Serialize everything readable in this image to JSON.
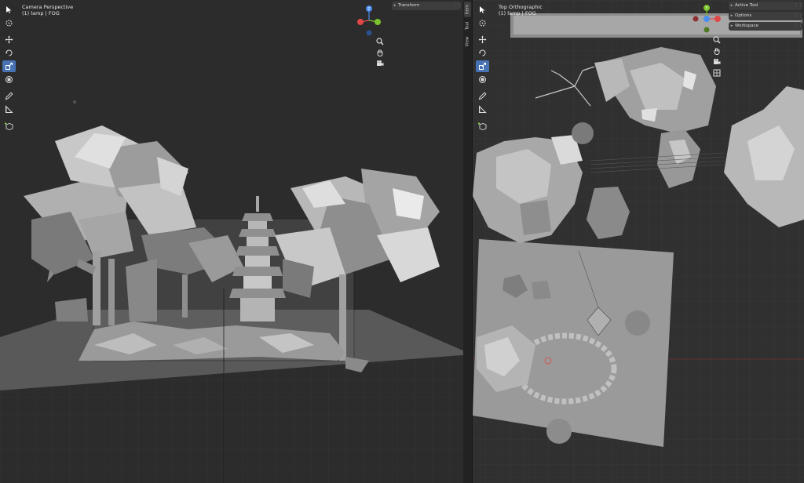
{
  "left_viewport": {
    "view_name": "Camera Perspective",
    "collection_info": "(1) lamp | FOG",
    "sidebar_panel": "Transform",
    "sidebar_tabs": [
      "Item",
      "Tool",
      "View"
    ]
  },
  "right_viewport": {
    "view_name": "Top Orthographic",
    "collection_info": "(1) lamp | FOG",
    "sidebar_panels": [
      "Active Tool",
      "Options",
      "Workspace"
    ]
  },
  "tools": [
    "select-box",
    "cursor",
    "move",
    "rotate",
    "scale",
    "transform",
    "annotate",
    "measure",
    "add-cube"
  ],
  "gizmo_axes": {
    "x": "X",
    "y": "Y",
    "z": "Z"
  },
  "colors": {
    "x_axis": "#e04848",
    "y_axis": "#7cc42b",
    "z_axis": "#4a8ef0",
    "active_tool": "#4772b3"
  }
}
